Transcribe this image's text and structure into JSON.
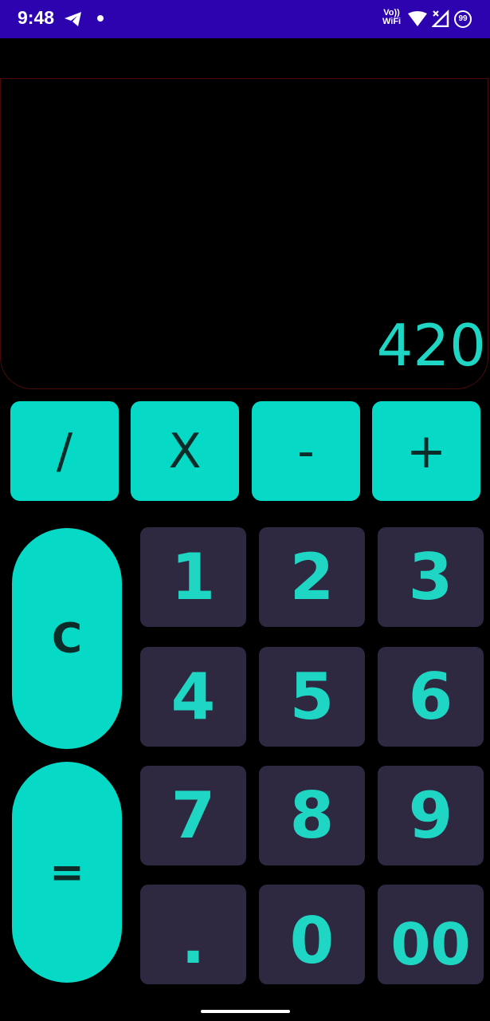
{
  "status_bar": {
    "time": "9:48",
    "wifi_label_top": "Vo))",
    "wifi_label_bottom": "WiFi",
    "battery": "99",
    "background": "#2d03b0"
  },
  "display": {
    "value": "420",
    "text_color": "#1fd6c4"
  },
  "operators": [
    {
      "label": "/",
      "name": "divide-button"
    },
    {
      "label": "X",
      "name": "multiply-button"
    },
    {
      "label": "-",
      "name": "subtract-button"
    },
    {
      "label": "+",
      "name": "add-button"
    }
  ],
  "clear_label": "C",
  "equals_label": "=",
  "keypad": [
    [
      "1",
      "2",
      "3"
    ],
    [
      "4",
      "5",
      "6"
    ],
    [
      "7",
      "8",
      "9"
    ],
    [
      ".",
      "0",
      "00"
    ]
  ],
  "colors": {
    "accent": "#06d9c6",
    "key_background": "#2e2840",
    "key_text": "#1fd6c4",
    "operator_text": "#0c2c2a"
  }
}
